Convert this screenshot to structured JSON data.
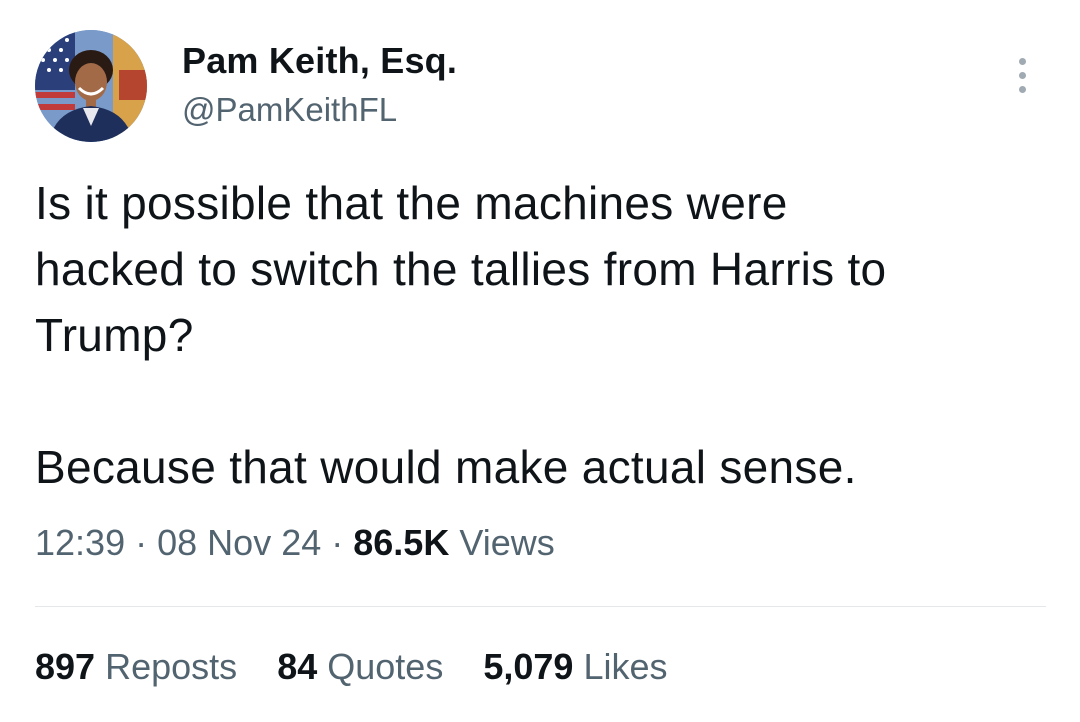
{
  "author": {
    "display_name": "Pam Keith, Esq.",
    "handle": "@PamKeithFL",
    "avatar_icon": "profile-photo"
  },
  "tweet": {
    "lines": [
      "Is it possible that the machines were",
      "hacked to switch the tallies from Harris to",
      "Trump?",
      "Because that would make actual sense."
    ]
  },
  "meta": {
    "time": "12:39",
    "separator": "·",
    "date": "08 Nov 24",
    "views_count": "86.5K",
    "views_label": "Views"
  },
  "stats": {
    "reposts_count": "897",
    "reposts_label": "Reposts",
    "quotes_count": "84",
    "quotes_label": "Quotes",
    "likes_count": "5,079",
    "likes_label": "Likes"
  },
  "colors": {
    "primary_text": "#0f1419",
    "secondary_text": "#536471",
    "divider": "#e4e8eb"
  },
  "icons": {
    "more": "more-vertical-icon"
  }
}
